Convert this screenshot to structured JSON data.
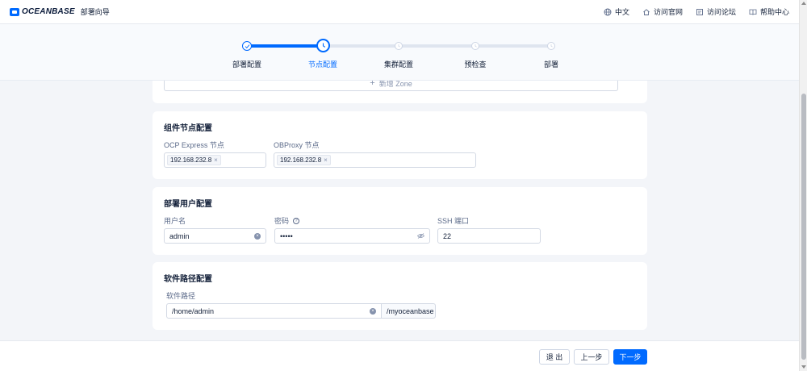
{
  "header": {
    "logo": "OCEANBASE",
    "title": "部署向导",
    "links": [
      {
        "label": "中文",
        "icon": "globe-icon"
      },
      {
        "label": "访问官网",
        "icon": "home-icon"
      },
      {
        "label": "访问论坛",
        "icon": "forum-icon"
      },
      {
        "label": "帮助中心",
        "icon": "book-icon"
      }
    ]
  },
  "steps": [
    {
      "label": "部署配置",
      "state": "done"
    },
    {
      "label": "节点配置",
      "state": "active"
    },
    {
      "label": "集群配置",
      "state": "pending"
    },
    {
      "label": "预检查",
      "state": "pending"
    },
    {
      "label": "部署",
      "state": "pending"
    }
  ],
  "zone": {
    "add_label": "新增 Zone"
  },
  "component_nodes": {
    "title": "组件节点配置",
    "ocp_express_label": "OCP Express 节点",
    "ocp_express_value": "192.168.232.8",
    "obproxy_label": "OBProxy 节点",
    "obproxy_value": "192.168.232.8"
  },
  "deploy_user": {
    "title": "部署用户配置",
    "username_label": "用户名",
    "username_value": "admin",
    "password_label": "密码",
    "password_value": "•••••",
    "ssh_port_label": "SSH 端口",
    "ssh_port_value": "22"
  },
  "software_path": {
    "title": "软件路径配置",
    "path_label": "软件路径",
    "path_value": "/home/admin",
    "path_suffix": "/myoceanbase"
  },
  "footer": {
    "exit_label": "退 出",
    "prev_label": "上一步",
    "next_label": "下一步"
  },
  "colors": {
    "primary": "#006aff",
    "step_pending": "#cdd5e4"
  }
}
